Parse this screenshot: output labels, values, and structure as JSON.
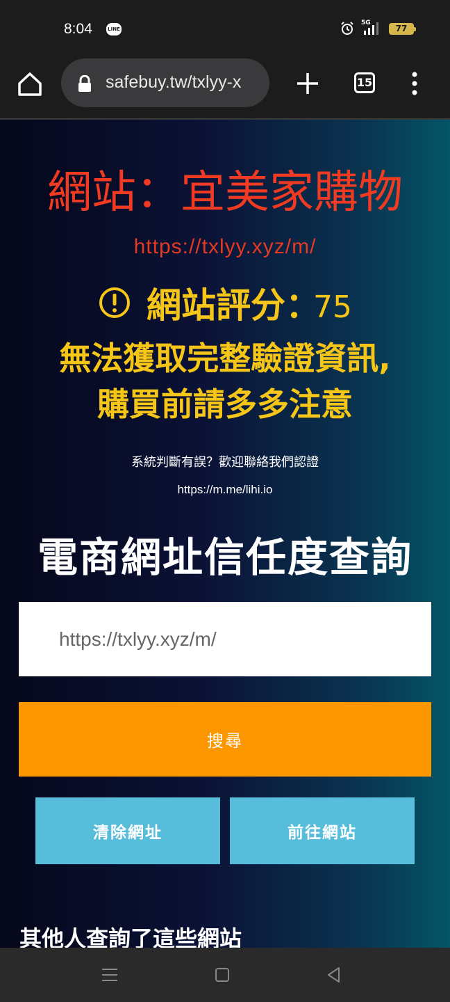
{
  "status_bar": {
    "time": "8:04",
    "line_icon_text": "LINE",
    "network": "5G",
    "battery": "77"
  },
  "browser": {
    "url": "safebuy.tw/txlyy-x",
    "tab_count": "15"
  },
  "page": {
    "site_title": "網站：宜美家購物",
    "site_url": "https://txlyy.xyz/m/",
    "score_label": "網站評分：",
    "score_value": "75",
    "warning_line1": "無法獲取完整驗證資訊,",
    "warning_line2": "購買前請多多注意",
    "feedback_note": "系統判斷有誤？歡迎聯絡我們認證",
    "contact_link": "https://m.me/lihi.io",
    "heading": "電商網址信任度查詢",
    "search_value": "https://txlyy.xyz/m/",
    "search_button": "搜尋",
    "clear_button": "清除網址",
    "goto_button": "前往網站",
    "others_heading": "其他人查詢了這些網站"
  },
  "colors": {
    "title_red": "#f03a22",
    "warning_yellow": "#f5c518",
    "search_orange": "#fc9700",
    "button_blue": "#57bddb"
  }
}
